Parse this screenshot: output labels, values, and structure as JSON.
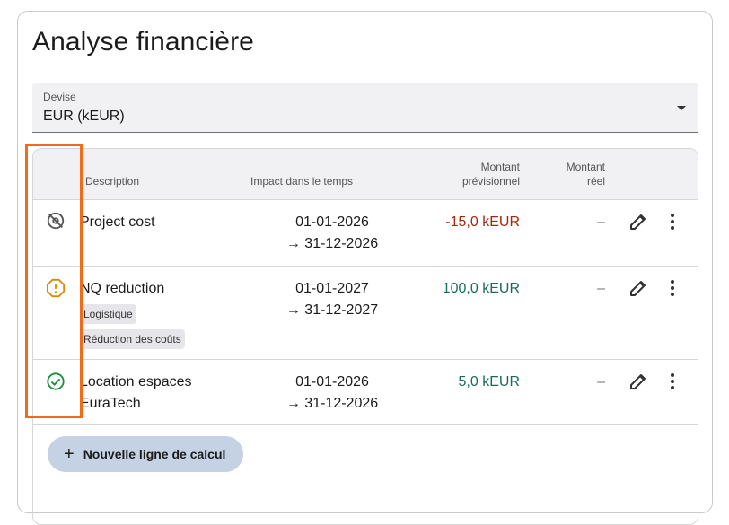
{
  "page": {
    "title": "Analyse financière"
  },
  "currency": {
    "label": "Devise",
    "value": "EUR (kEUR)"
  },
  "table": {
    "headers": {
      "description": "Description",
      "impact": "Impact dans le temps",
      "montant_prev_1": "Montant",
      "montant_prev_2": "prévisionnel",
      "montant_reel_1": "Montant",
      "montant_reel_2": "réel"
    },
    "rows": [
      {
        "status": "hidden-eye-off-icon",
        "description": "Project cost",
        "start": "01-01-2026",
        "end": "→ 31-12-2026",
        "amount": "-15,0 kEUR",
        "real": "–",
        "tags": []
      },
      {
        "status": "warning-icon",
        "description": "NQ reduction",
        "start": "01-01-2027",
        "end": "→ 31-12-2027",
        "amount": "100,0 kEUR",
        "real": "–",
        "tags": [
          "Logistique",
          "Réduction des coûts"
        ]
      },
      {
        "status": "check-circle-icon",
        "description": "Location espaces EuraTech",
        "start": "01-01-2026",
        "end": "→ 31-12-2026",
        "amount": "5,0 kEUR",
        "real": "–",
        "tags": []
      }
    ]
  },
  "actions": {
    "add_label": "Nouvelle ligne de calcul"
  },
  "colors": {
    "negative": "#a3280f",
    "positive": "#1a6c5a",
    "warning": "#e08a00",
    "success": "#1e8e3e",
    "highlight": "#f26a1b"
  }
}
